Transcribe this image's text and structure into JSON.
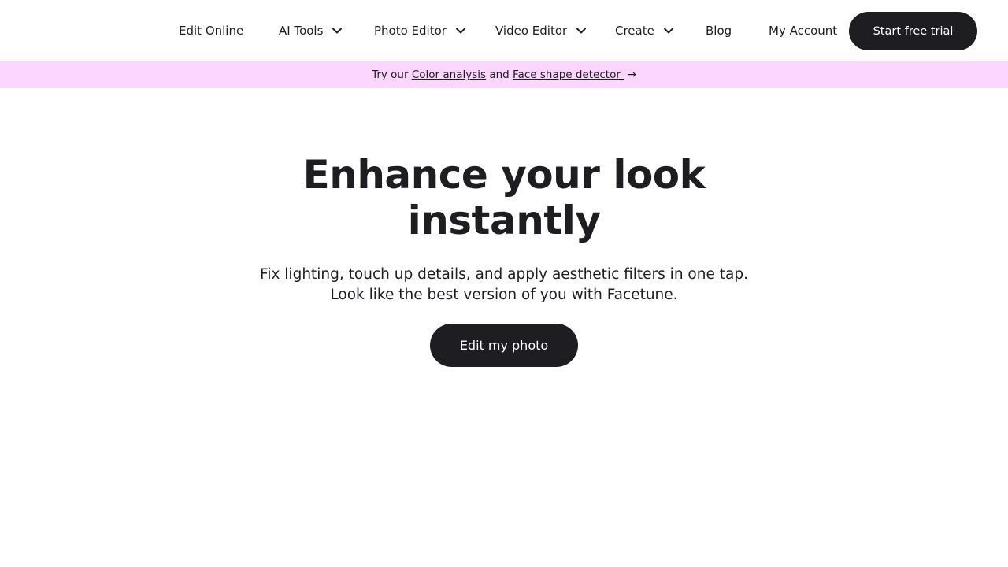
{
  "nav": {
    "items": [
      {
        "label": "Edit Online",
        "has_dropdown": false
      },
      {
        "label": "AI Tools",
        "has_dropdown": true
      },
      {
        "label": "Photo Editor",
        "has_dropdown": true
      },
      {
        "label": "Video Editor",
        "has_dropdown": true
      },
      {
        "label": "Create",
        "has_dropdown": true
      },
      {
        "label": "Blog",
        "has_dropdown": false
      },
      {
        "label": "My Account",
        "has_dropdown": false
      }
    ],
    "cta_label": "Start free trial"
  },
  "banner": {
    "prefix": "Try our ",
    "link1": "Color analysis",
    "middle": " and ",
    "link2": "Face shape detector ",
    "arrow": "→"
  },
  "hero": {
    "title_line1": "Enhance your look",
    "title_line2": "instantly",
    "subtitle_line1": "Fix lighting, touch up details, and apply aesthetic filters in one tap.",
    "subtitle_line2": "Look like the best version of you with Facetune.",
    "cta_label": "Edit my photo"
  },
  "colors": {
    "dark": "#1e1d22",
    "banner_bg": "#fdd6ff",
    "background": "#ffffff"
  },
  "icons": {
    "dropdown": "chevron-down-icon",
    "banner_arrow": "arrow-right-icon"
  }
}
